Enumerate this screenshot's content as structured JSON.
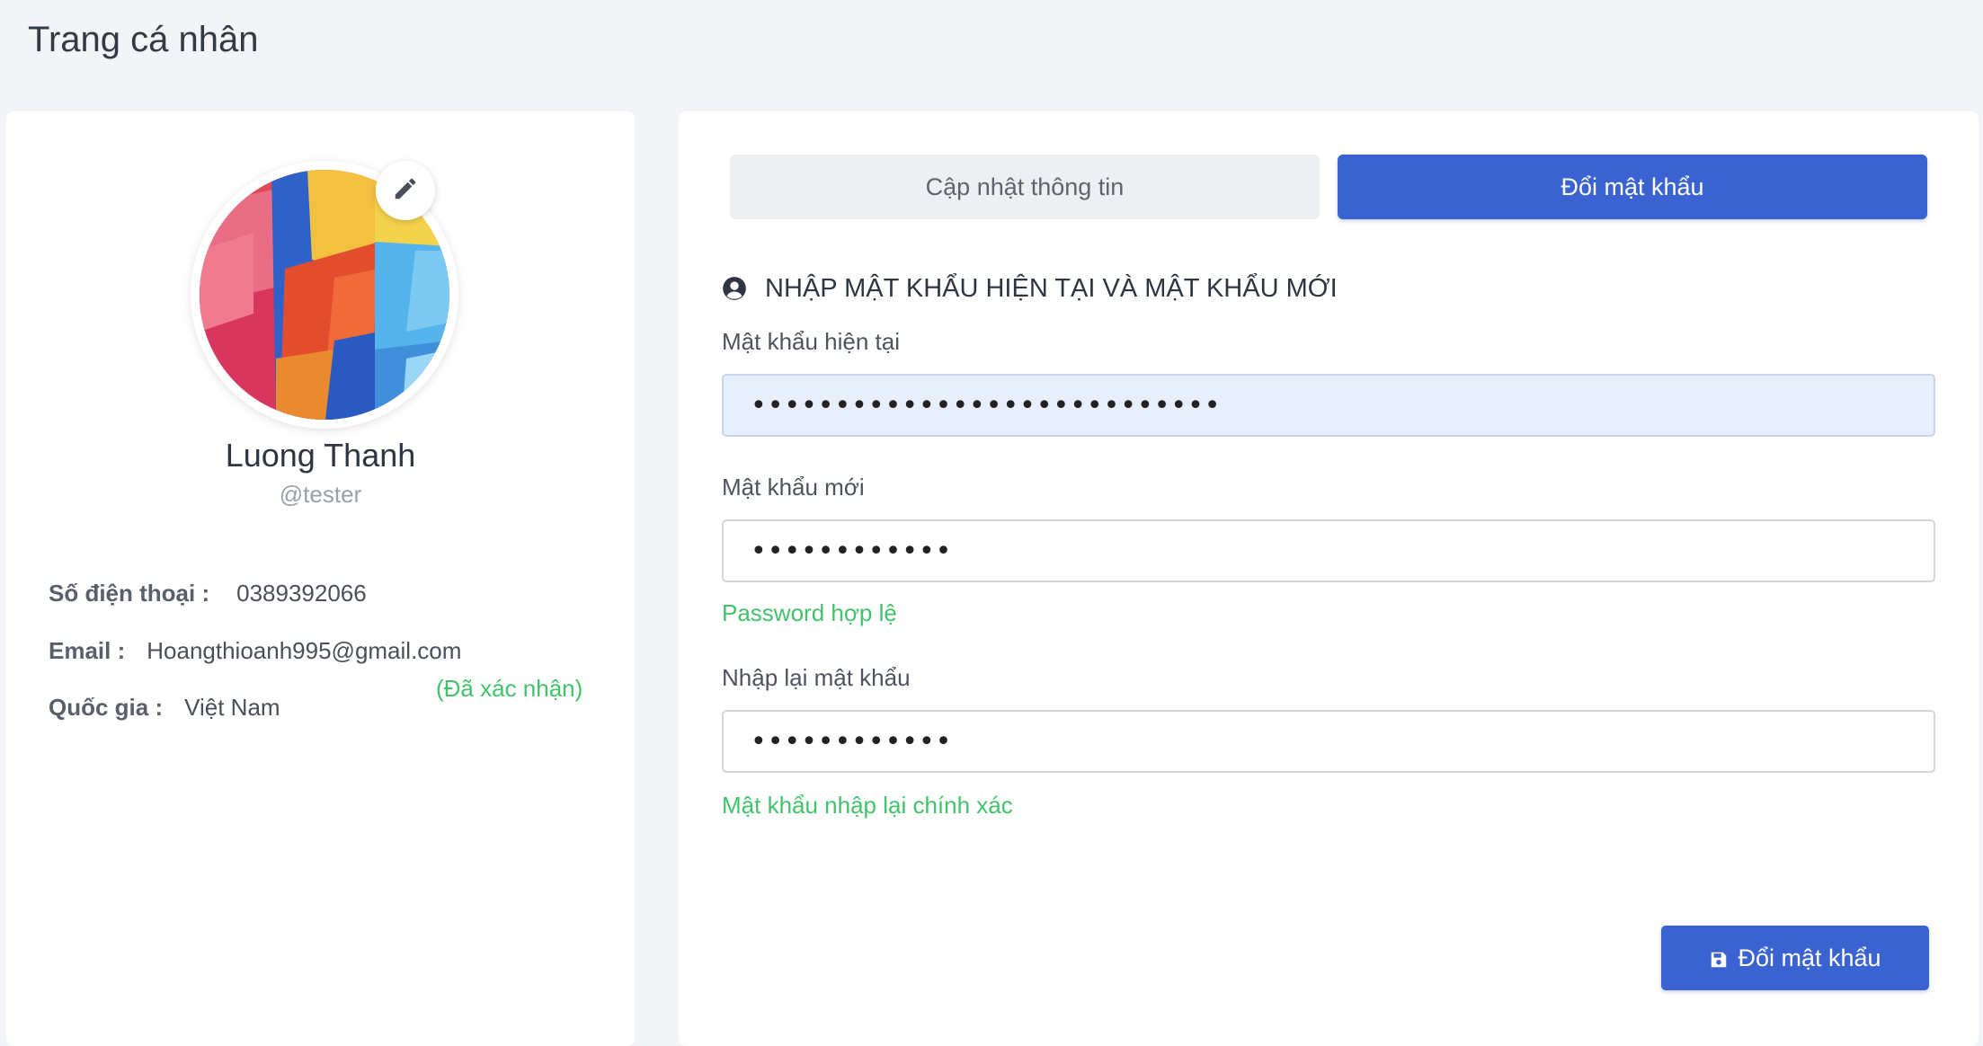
{
  "header": {
    "title": "Trang cá nhân"
  },
  "profile": {
    "name": "Luong Thanh",
    "handle": "@tester",
    "phone_label": "Số điện thoại :",
    "phone": "0389392066",
    "email_label": "Email :",
    "email": "Hoangthioanh995@gmail.com",
    "email_status": "(Đã xác nhận)",
    "country_label": "Quốc gia :",
    "country": "Việt Nam",
    "edit_icon": "pencil-icon"
  },
  "tabs": [
    {
      "label": "Cập nhật thông tin",
      "active": false
    },
    {
      "label": "Đổi mật khẩu",
      "active": true
    }
  ],
  "form": {
    "section_title": "NHẬP MẬT KHẨU HIỆN TẠI VÀ MẬT KHẨU MỚI",
    "section_icon": "user-circle-icon",
    "current_password": {
      "label": "Mật khẩu hiện tại",
      "value": "............................"
    },
    "new_password": {
      "label": "Mật khẩu mới",
      "value": "............",
      "hint": "Password hợp lệ"
    },
    "confirm_password": {
      "label": "Nhập lại mật khẩu",
      "value": "............",
      "hint": "Mật khẩu nhập lại chính xác"
    },
    "submit_label": "Đổi mật khẩu",
    "submit_icon": "save-icon"
  },
  "colors": {
    "primary": "#3a63d1",
    "success": "#42c36b",
    "background": "#f3f4f8"
  }
}
